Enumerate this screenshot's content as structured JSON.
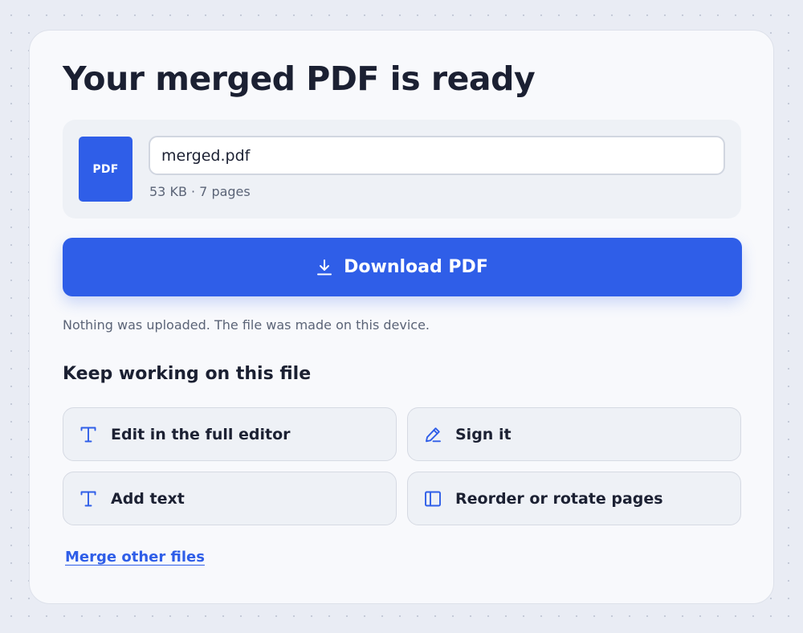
{
  "page": {
    "title": "Your merged PDF is ready"
  },
  "file": {
    "badge_label": "PDF",
    "filename_value": "merged.pdf",
    "meta": "53  KB · 7 pages"
  },
  "download": {
    "label": "Download PDF",
    "icon": "download-icon"
  },
  "privacy_note": "Nothing was uploaded. The file was made on this device.",
  "next_steps": {
    "heading": "Keep working on this file",
    "actions": [
      {
        "label": "Edit in the full editor",
        "icon": "text-icon"
      },
      {
        "label": "Sign it",
        "icon": "pen-icon"
      },
      {
        "label": "Add text",
        "icon": "text-icon"
      },
      {
        "label": "Reorder or rotate pages",
        "icon": "panel-icon"
      }
    ]
  },
  "merge_link": "Merge other files",
  "colors": {
    "accent": "#2f5ee8",
    "background": "#e9ecf4",
    "card": "#f8f9fc",
    "panel": "#eef1f6",
    "text_primary": "#1b2032",
    "text_muted": "#5b6477"
  }
}
